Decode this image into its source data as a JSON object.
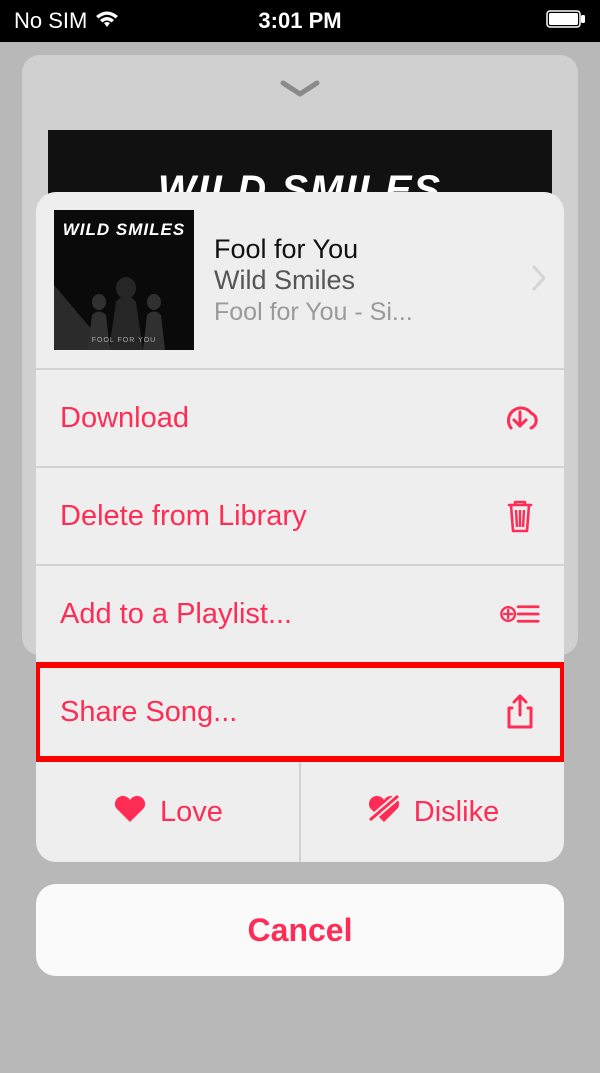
{
  "status_bar": {
    "carrier": "No SIM",
    "time": "3:01 PM"
  },
  "background": {
    "album_banner_text": "WILD SMILES"
  },
  "song": {
    "title": "Fool for You",
    "artist": "Wild Smiles",
    "album": "Fool for You - Si...",
    "thumb_title": "WILD SMILES",
    "thumb_album": "FOOL FOR YOU"
  },
  "actions": {
    "download": "Download",
    "delete": "Delete from Library",
    "add_playlist": "Add to a Playlist...",
    "share": "Share Song...",
    "love": "Love",
    "dislike": "Dislike",
    "cancel": "Cancel"
  },
  "colors": {
    "accent": "#ff2d55",
    "highlight": "#ff0000"
  }
}
